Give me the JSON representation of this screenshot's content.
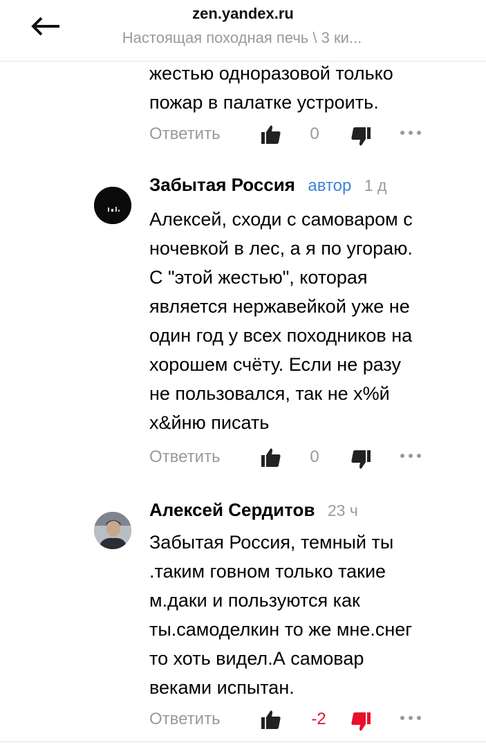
{
  "header": {
    "domain": "zen.yandex.ru",
    "title": "Настоящая походная печь \\ 3 ки..."
  },
  "comments": [
    {
      "text_lines": [
        "жестью одноразовой только",
        "пожар в палатке устроить."
      ],
      "reply_label": "Ответить",
      "likes": "0"
    },
    {
      "author": "Забытая Россия",
      "badge": "автор",
      "time": "1 д",
      "text_lines": [
        "Алексей, сходи с самоваром с",
        "ночевкой в лес, а я по угораю.",
        "С \"этой жестью\", которая",
        "является нержавейкой уже не",
        "один год у всех походников на",
        "хорошем счёту. Если не разу",
        "не пользовался, так не х%й",
        "х&йню писать"
      ],
      "reply_label": "Ответить",
      "likes": "0"
    },
    {
      "author": "Алексей Сердитов",
      "time": "23 ч",
      "text_lines": [
        "Забытая Россия, темный ты",
        ".таким говном только такие",
        "м.даки и пользуются как",
        "ты.самоделкин то же мне.снег",
        "то хоть видел.А самовар",
        "веками испытан."
      ],
      "reply_label": "Ответить",
      "likes": "-2"
    }
  ],
  "icons": {
    "back": "arrow-left-icon",
    "like": "thumbs-up-icon",
    "dislike": "thumbs-down-icon",
    "more": "more-dots-icon"
  },
  "colors": {
    "accent_author": "#3b83d6",
    "negative": "#e8102c",
    "muted": "#9a9a9a",
    "icon": "#222222"
  }
}
